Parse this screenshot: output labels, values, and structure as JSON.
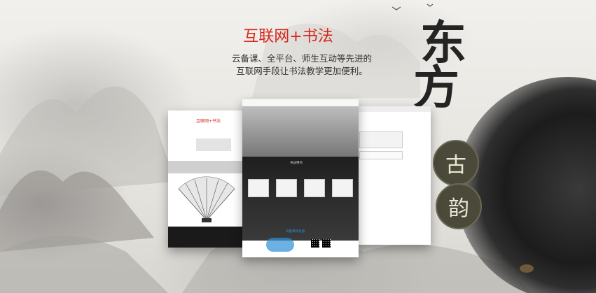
{
  "banner": {
    "headline": "互联网+书法",
    "subtitle_line1": "云备课、全平台、师生互动等先进的",
    "subtitle_line2": "互联网手段让书法教学更加便利。"
  },
  "calligraphy": {
    "char_top": "东",
    "char_bottom": "方",
    "seal_top": "古",
    "seal_bottom": "韵"
  },
  "mockups": {
    "left": {
      "title": "互联网+书法"
    },
    "center": {
      "section1": "书法特点",
      "section2": "海量课件资源"
    }
  },
  "colors": {
    "accent": "#d7261b",
    "ink": "#242424",
    "paper": "#e9e7e2"
  }
}
